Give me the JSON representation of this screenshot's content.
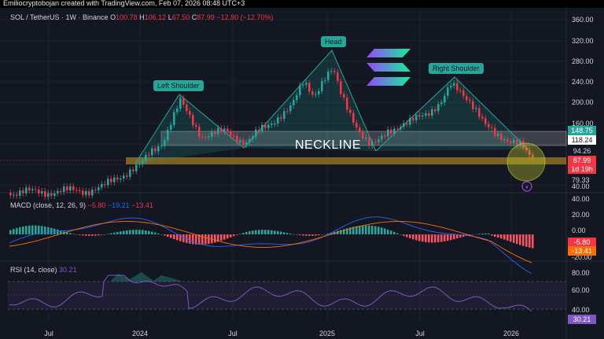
{
  "header": {
    "credit": "Emiliocryptobojan created with TradingView.com, Feb 07, 2026 08:48 UTC+3"
  },
  "legend": {
    "symbol": "SOL / TetherUS · 1W · Binance",
    "o_label": "O",
    "o": "100.78",
    "h_label": "H",
    "h": "106.12",
    "l_label": "L",
    "l": "67.50",
    "c_label": "C",
    "c": "87.99",
    "change": "−12.80 (−12.70%)"
  },
  "macd": {
    "label": "MACD (close, 12, 26, 9)",
    "v1": "−5.80",
    "v2": "−19.21",
    "v3": "−13.41"
  },
  "rsi": {
    "label": "RSI (14, close)",
    "value": "30.21"
  },
  "price_axis": {
    "ticks": [
      "360.00",
      "320.00",
      "280.00",
      "240.00",
      "200.00",
      "160.00",
      "120.00",
      "79.33",
      "40.00"
    ]
  },
  "price_tags": {
    "t1": "148.75",
    "t2": "118.24",
    "t3": "94.26",
    "t4": "87.99",
    "t5": "1d 19h"
  },
  "macd_axis": {
    "ticks": [
      "40.00",
      "20.00",
      "0.00",
      "-20.00"
    ],
    "tag_a": "-5.80",
    "tag_b": "-13.41"
  },
  "rsi_axis": {
    "ticks": [
      "80.00",
      "60.00",
      "40.00"
    ],
    "tag": "30.21"
  },
  "time_axis": {
    "labels": [
      "Jul",
      "2024",
      "Jul",
      "2025",
      "Jul",
      "2026"
    ]
  },
  "annotations": {
    "left_shoulder": "Left Shoulder",
    "head": "Head",
    "right_shoulder": "Right Shoulder",
    "neckline": "NECKLINE"
  },
  "colors": {
    "up": "#26a69a",
    "down": "#f23645",
    "background": "#131722",
    "macd_line": "#2962ff",
    "signal_line": "#ff6d00",
    "rsi_line": "#7e57c2",
    "pattern": "#26a69a",
    "neck_band": "#d1d4dc",
    "support_band": "#c9a227"
  }
}
